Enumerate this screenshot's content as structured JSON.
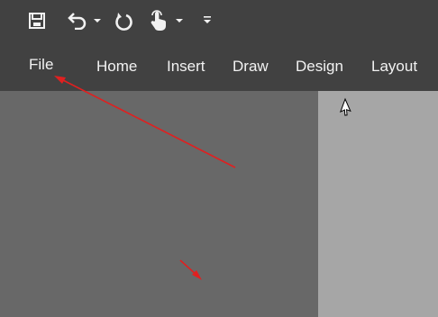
{
  "quick_access_toolbar": {
    "items": [
      {
        "name": "save",
        "icon": "save-icon"
      },
      {
        "name": "undo",
        "icon": "undo-icon"
      },
      {
        "name": "undo-dropdown",
        "icon": "chevron-down-icon"
      },
      {
        "name": "redo",
        "icon": "redo-icon"
      },
      {
        "name": "touch-mode",
        "icon": "touch-mode-icon"
      },
      {
        "name": "touch-mode-dropdown",
        "icon": "chevron-down-icon"
      },
      {
        "name": "customize",
        "icon": "customize-qat-icon"
      }
    ]
  },
  "ribbon_tabs": [
    {
      "label": "File"
    },
    {
      "label": "Home"
    },
    {
      "label": "Insert"
    },
    {
      "label": "Draw"
    },
    {
      "label": "Design"
    },
    {
      "label": "Layout"
    }
  ],
  "colors": {
    "ribbon": "#414141",
    "workspace": "#686868",
    "page": "#a6a6a6",
    "annotation_arrow": "#e02020"
  },
  "cursor": {
    "icon": "mouse-pointer-icon"
  }
}
